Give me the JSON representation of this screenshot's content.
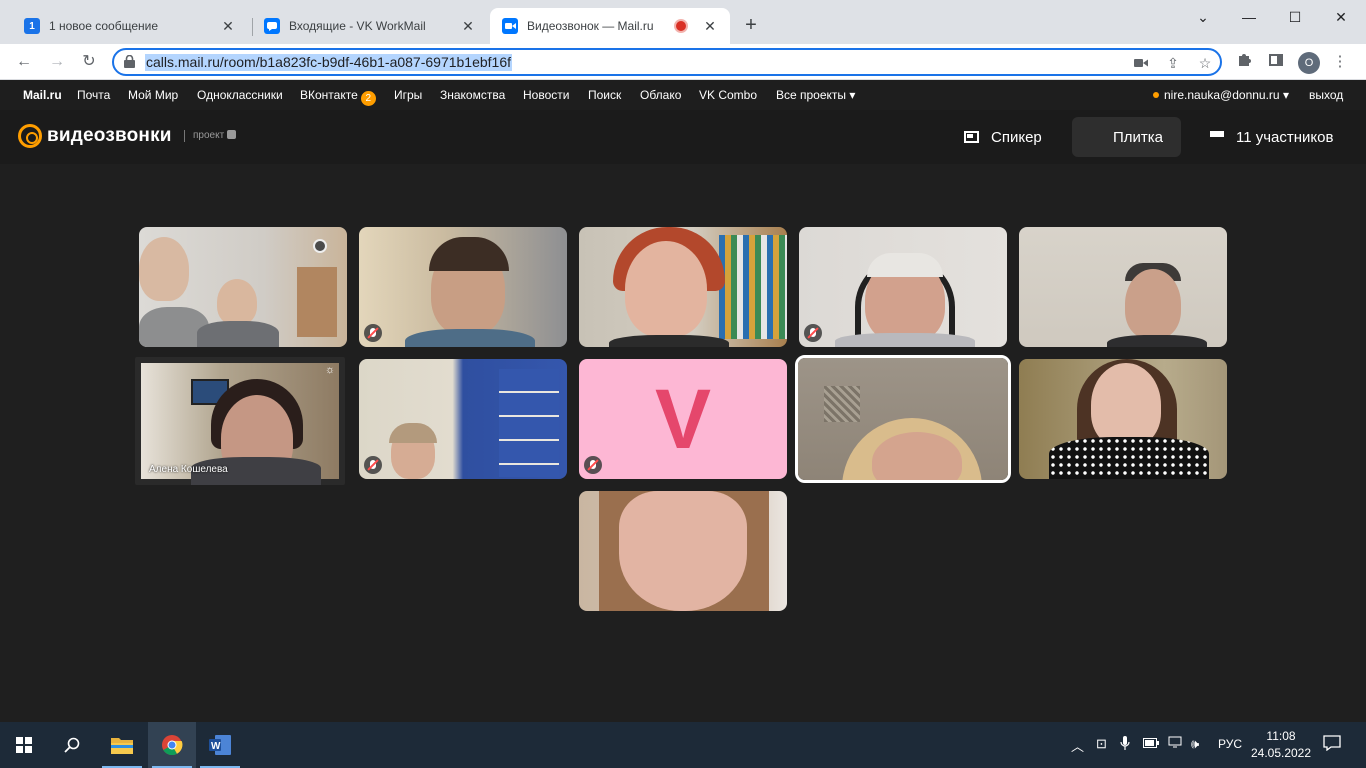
{
  "browser": {
    "tabs": [
      {
        "title": "1 новое сообщение",
        "favicon": "1"
      },
      {
        "title": "Входящие - VK WorkMail",
        "favicon": ""
      },
      {
        "title": "Видеозвонок — Mail.ru",
        "favicon": ""
      }
    ],
    "url": "calls.mail.ru/room/b1a823fc-b9df-46b1-a087-6971b1ebf16f",
    "profile_initial": "O"
  },
  "portal": {
    "links": [
      "Mail.ru",
      "Почта",
      "Мой Мир",
      "Одноклассники",
      "ВКонтакте",
      "Игры",
      "Знакомства",
      "Новости",
      "Поиск",
      "Облако",
      "VK Combo",
      "Все проекты"
    ],
    "vk_badge": "2",
    "user_email": "nire.nauka@donnu.ru",
    "logout": "выход"
  },
  "app": {
    "logo_text": "видеозвонки",
    "logo_sub": "проект",
    "speaker_label": "Спикер",
    "tile_label": "Плитка",
    "participants_label": "11 участников"
  },
  "tiles": {
    "t6_name": "Алена Кошелева",
    "t8_letter": "V"
  },
  "taskbar": {
    "lang": "РУС",
    "time": "11:08",
    "date": "24.05.2022"
  },
  "colors": {
    "accent": "#ff9e00",
    "call_bg": "#1f1f1f",
    "omnibox_focus": "#1a73e8",
    "avatar_tile_bg": "#fdb7d4",
    "avatar_letter": "#e5476c"
  }
}
